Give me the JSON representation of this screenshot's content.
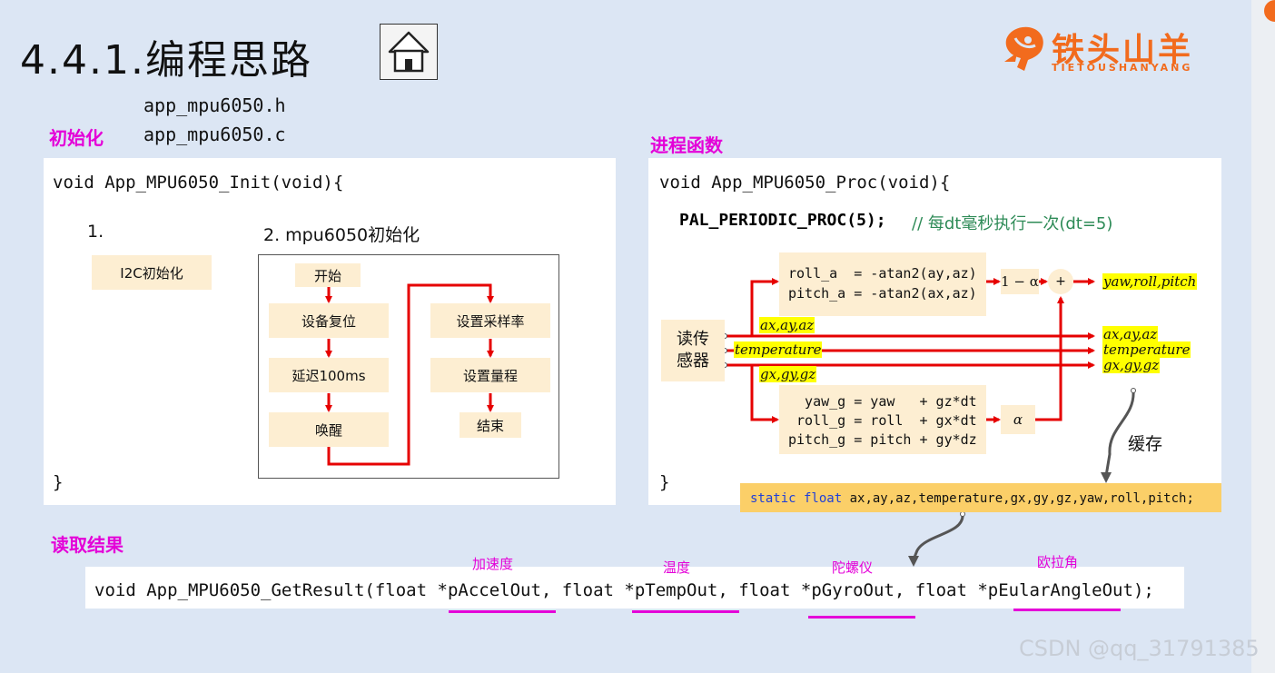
{
  "header": {
    "title": "4.4.1.编程思路",
    "home_icon": "home-icon",
    "logo": {
      "text": "铁头山羊",
      "subtext": "TIETOUSHANYANG",
      "mascot_icon": "goat-mascot-icon",
      "color": "#f26b1d"
    }
  },
  "files": {
    "header_file": "app_mpu6050.h",
    "source_file": "app_mpu6050.c"
  },
  "init": {
    "label": "初始化",
    "signature": "void App_MPU6050_Init(void){",
    "close": "}",
    "step1_label": "1.",
    "step1_node": "I2C初始化",
    "step2_label": "2. mpu6050初始化",
    "flow": {
      "start": "开始",
      "reset": "设备复位",
      "delay": "延迟100ms",
      "wake": "唤醒",
      "sample_rate": "设置采样率",
      "range": "设置量程",
      "end": "结束"
    }
  },
  "proc": {
    "label": "进程函数",
    "signature": "void App_MPU6050_Proc(void){",
    "close": "}",
    "periodic": "PAL_PERIODIC_PROC(5);",
    "comment": "// 每dt毫秒执行一次(dt=5)",
    "sensor_node": "读传\n感器",
    "accel_formula": "roll_a  = -atan2(ay,az)\npitch_a = -atan2(ax,az)",
    "gyro_formula": "  yaw_g = yaw   + gz*dt\n roll_g = roll  + gx*dt\npitch_g = pitch + gy*dz",
    "one_minus_alpha": "1 − α",
    "alpha": "α",
    "plus": "+",
    "output_angles": "yaw,roll,pitch",
    "signal_accel": "ax,ay,az",
    "signal_temp": "temperature",
    "signal_gyro": "gx,gy,gz",
    "out_accel": "ax,ay,az",
    "out_temp": "temperature",
    "out_gyro": "gx,gy,gz",
    "cache_label": "缓存",
    "static_decl_keywords": "static float",
    "static_decl_vars": "ax,ay,az,temperature,gx,gy,gz,yaw,roll,pitch;"
  },
  "result": {
    "label": "读取结果",
    "code_prefix": "void App_MPU6050_GetResult(float ",
    "param1": "*pAccelOut",
    "sep1": ", float ",
    "param2": "*pTempOut",
    "sep2": ", float ",
    "param3": "*pGyroOut",
    "sep3": ", float ",
    "param4": "*pEularAngleOut",
    "code_suffix": ");",
    "ann1": "加速度",
    "ann2": "温度",
    "ann3": "陀螺仪",
    "ann4": "欧拉角"
  },
  "watermark": "CSDN @qq_31791385",
  "colors": {
    "background": "#dce6f4",
    "node": "#fdeed2",
    "arrow": "#e60000",
    "label": "#e400d8",
    "highlight": "#ffff00",
    "static_bar": "#fbcf68"
  }
}
